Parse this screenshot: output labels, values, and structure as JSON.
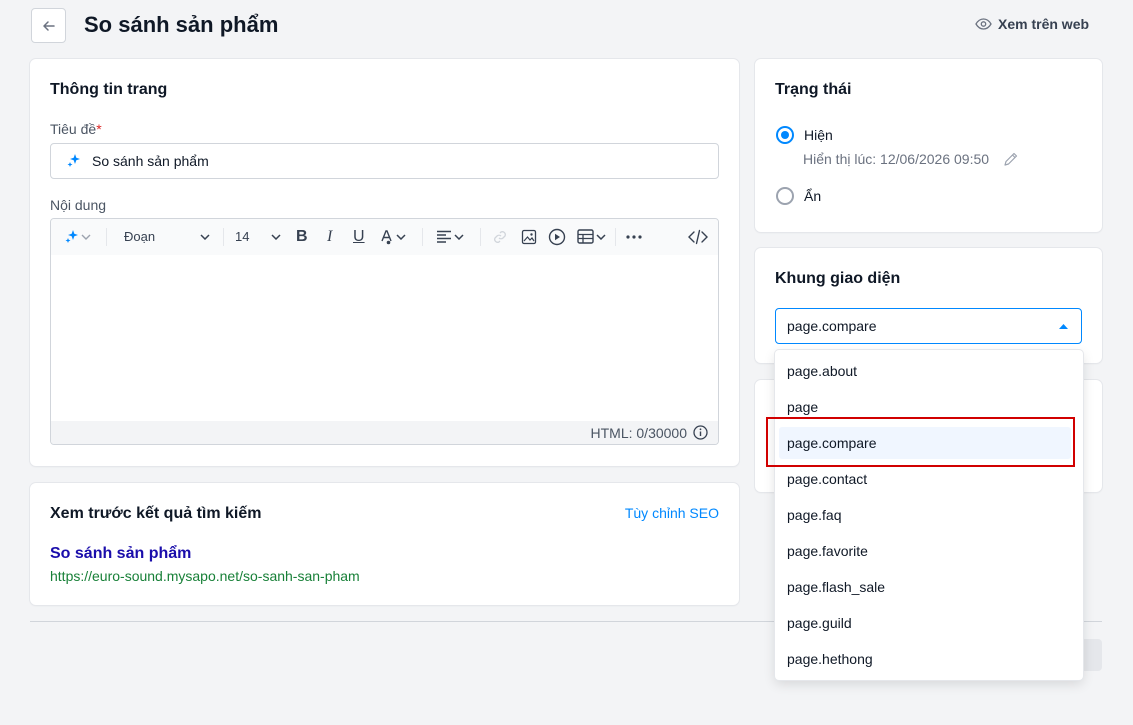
{
  "header": {
    "title": "So sánh sản phẩm",
    "view_on_web": "Xem trên web"
  },
  "page_info": {
    "card_title": "Thông tin trang",
    "title_label": "Tiêu đề",
    "required_mark": "*",
    "title_value": "So sánh sản phẩm",
    "content_label": "Nội dung",
    "toolbar": {
      "paragraph": "Đoạn",
      "font_size": "14"
    },
    "html_counter": "HTML: 0/30000"
  },
  "seo": {
    "card_title": "Xem trước kết quả tìm kiếm",
    "customize_link": "Tùy chỉnh SEO",
    "preview_title": "So sánh sản phẩm",
    "preview_url": "https://euro-sound.mysapo.net/so-sanh-san-pham"
  },
  "status": {
    "card_title": "Trạng thái",
    "visible_label": "Hiện",
    "visible_time": "Hiển thị lúc: 12/06/2026 09:50",
    "hidden_label": "Ẩn"
  },
  "template": {
    "card_title": "Khung giao diện",
    "selected": "page.compare",
    "options": [
      "page.about",
      "page",
      "page.compare",
      "page.contact",
      "page.faq",
      "page.favorite",
      "page.flash_sale",
      "page.guild",
      "page.hethong"
    ]
  },
  "colors": {
    "accent": "#0088ff",
    "link_title": "#1a0dab",
    "link_url": "#188038",
    "highlight": "#d10000"
  }
}
